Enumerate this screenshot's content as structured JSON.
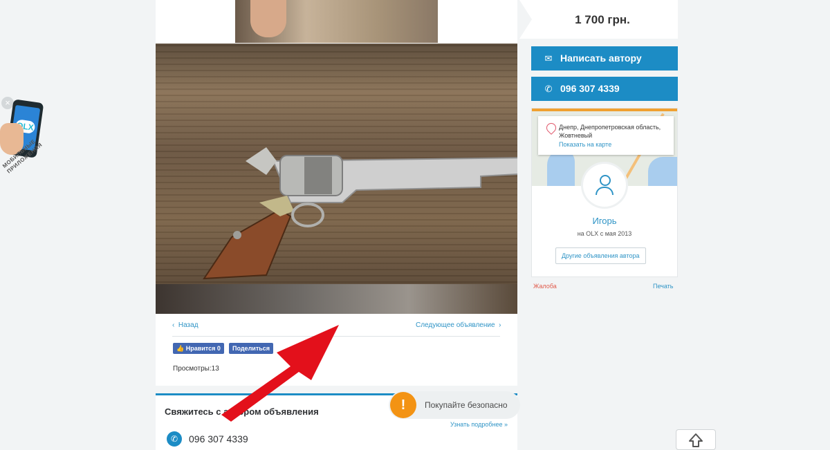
{
  "promo": {
    "close_label": "×",
    "logo_text": "OLX",
    "text": "МОБИЛЬНЫЕ ПРИЛОЖЕНИЯ"
  },
  "ad": {
    "nav_back": "Назад",
    "nav_next": "Следующее объявление",
    "fb_like": "Нравится 0",
    "fb_share": "Поделиться",
    "views_label": "Просмотры:",
    "views_value": "13"
  },
  "contact": {
    "title": "Свяжитесь с автором объявления",
    "phone": "096 307 4339",
    "safe_label": "Покупайте безопасно",
    "safe_icon": "!",
    "safe_more": "Узнать подробнее »"
  },
  "sidebar": {
    "price": "1 700 грн.",
    "write_label": "Написать автору",
    "phone_label": "096 307 4339",
    "address": "Днепр, Днепропетровская область, Жовтневый",
    "show_map": "Показать на карте",
    "seller_name": "Игорь",
    "seller_since": "на OLX с мая 2013",
    "other_ads": "Другие объявления автора",
    "complaint": "Жалоба",
    "print": "Печать"
  },
  "colors": {
    "accent": "#1c8cc5",
    "warning": "#f39314",
    "arrow": "#e3101b",
    "facebook": "#4267b2"
  }
}
